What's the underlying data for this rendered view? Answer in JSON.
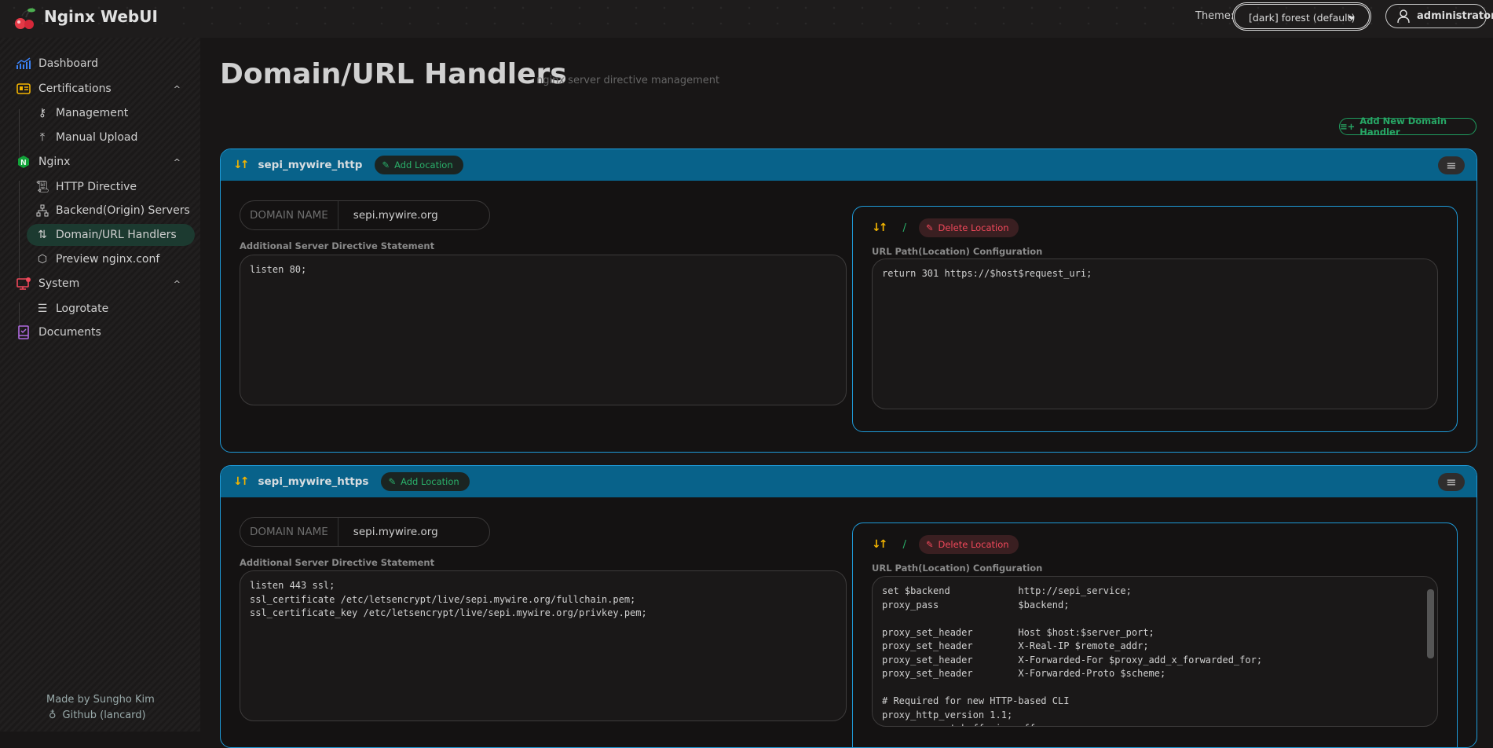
{
  "app": {
    "title": "Nginx WebUI"
  },
  "topbar": {
    "theme_label": "Theme:",
    "theme_value": "[dark] forest (default)",
    "user": "administrator"
  },
  "sidebar": {
    "items": [
      {
        "label": "Dashboard",
        "icon": "chart-icon"
      },
      {
        "label": "Certifications",
        "icon": "id-card-icon"
      },
      {
        "label": "Management",
        "icon": "key-icon"
      },
      {
        "label": "Manual Upload",
        "icon": "upload-icon"
      },
      {
        "label": "Nginx",
        "icon": "nginx-icon"
      },
      {
        "label": "HTTP Directive",
        "icon": "scroll-icon"
      },
      {
        "label": "Backend(Origin) Servers",
        "icon": "sitemap-icon"
      },
      {
        "label": "Domain/URL Handlers",
        "icon": "route-icon"
      },
      {
        "label": "Preview nginx.conf",
        "icon": "hexagon-icon"
      },
      {
        "label": "System",
        "icon": "monitor-gear-icon"
      },
      {
        "label": "Logrotate",
        "icon": "lines-icon"
      },
      {
        "label": "Documents",
        "icon": "book-icon"
      }
    ],
    "footer_made_by": "Made by Sungho Kim",
    "footer_github": "Github (lancard)"
  },
  "page": {
    "title": "Domain/URL Handlers",
    "subtitle": "nginx server directive management",
    "add_button": "Add New Domain Handler"
  },
  "labels": {
    "add_location": "Add Location",
    "domain_name": "DOMAIN NAME",
    "additional": "Additional Server Directive Statement",
    "delete_location": "Delete Location",
    "url_config": "URL Path(Location) Configuration"
  },
  "handlers": [
    {
      "name": "sepi_mywire_http",
      "domain": "sepi.mywire.org",
      "directive": "listen 80;",
      "location": {
        "path": "/",
        "config": "return 301 https://$host$request_uri;"
      }
    },
    {
      "name": "sepi_mywire_https",
      "domain": "sepi.mywire.org",
      "directive": "listen 443 ssl;\nssl_certificate /etc/letsencrypt/live/sepi.mywire.org/fullchain.pem;\nssl_certificate_key /etc/letsencrypt/live/sepi.mywire.org/privkey.pem;",
      "location": {
        "path": "/",
        "config": "set $backend            http://sepi_service;\nproxy_pass              $backend;\n\nproxy_set_header        Host $host:$server_port;\nproxy_set_header        X-Real-IP $remote_addr;\nproxy_set_header        X-Forwarded-For $proxy_add_x_forwarded_for;\nproxy_set_header        X-Forwarded-Proto $scheme;\n\n# Required for new HTTP-based CLI\nproxy_http_version 1.1;\nproxy_request_buffering off;"
      }
    }
  ],
  "colors": {
    "accent": "#1e9ad8",
    "header": "#08628a",
    "green": "#2ab06a",
    "red": "#f0485a",
    "yellow": "#f3b400"
  }
}
